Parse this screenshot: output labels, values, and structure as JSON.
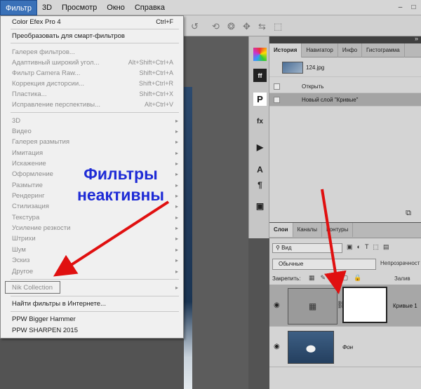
{
  "menubar": {
    "items": [
      "Фильтр",
      "3D",
      "Просмотр",
      "Окно",
      "Справка"
    ],
    "window_buttons": [
      "–",
      "□"
    ]
  },
  "filter_menu": {
    "items": [
      {
        "label": "Color Efex Pro 4",
        "shortcut": "Ctrl+F",
        "disabled": false
      },
      {
        "label": "Преобразовать для смарт-фильтров",
        "shortcut": "",
        "disabled": false
      },
      {
        "label": "Галерея фильтров...",
        "shortcut": "",
        "disabled": true
      },
      {
        "label": "Адаптивный широкий угол...",
        "shortcut": "Alt+Shift+Ctrl+A",
        "disabled": true
      },
      {
        "label": "Фильтр Camera Raw...",
        "shortcut": "Shift+Ctrl+A",
        "disabled": true
      },
      {
        "label": "Коррекция дисторсии...",
        "shortcut": "Shift+Ctrl+R",
        "disabled": true
      },
      {
        "label": "Пластика...",
        "shortcut": "Shift+Ctrl+X",
        "disabled": true
      },
      {
        "label": "Исправление перспективы...",
        "shortcut": "Alt+Ctrl+V",
        "disabled": true
      },
      {
        "label": "3D",
        "submenu": true,
        "disabled": true
      },
      {
        "label": "Видео",
        "submenu": true,
        "disabled": true
      },
      {
        "label": "Галерея размытия",
        "submenu": true,
        "disabled": true
      },
      {
        "label": "Имитация",
        "submenu": true,
        "disabled": true
      },
      {
        "label": "Искажение",
        "submenu": true,
        "disabled": true
      },
      {
        "label": "Оформление",
        "submenu": true,
        "disabled": true
      },
      {
        "label": "Размытие",
        "submenu": true,
        "disabled": true
      },
      {
        "label": "Рендеринг",
        "submenu": true,
        "disabled": true
      },
      {
        "label": "Стилизация",
        "submenu": true,
        "disabled": true
      },
      {
        "label": "Текстура",
        "submenu": true,
        "disabled": true
      },
      {
        "label": "Усиление резкости",
        "submenu": true,
        "disabled": true
      },
      {
        "label": "Штрихи",
        "submenu": true,
        "disabled": true
      },
      {
        "label": "Шум",
        "submenu": true,
        "disabled": true
      },
      {
        "label": "Эскиз",
        "submenu": true,
        "disabled": true
      },
      {
        "label": "Другое",
        "submenu": true,
        "disabled": true
      },
      {
        "label": "Nik Collection",
        "submenu": true,
        "disabled": true
      },
      {
        "label": "Найти фильтры в Интернете...",
        "shortcut": "",
        "disabled": false
      },
      {
        "label": "PPW Bigger Hammer",
        "shortcut": "",
        "disabled": false
      },
      {
        "label": "PPW SHARPEN 2015",
        "shortcut": "",
        "disabled": false
      }
    ]
  },
  "annotation": {
    "line1": "Фильтры",
    "line2": "неактивны"
  },
  "history_panel": {
    "tabs": [
      "История",
      "Навигатор",
      "Инфо",
      "Гистограмма"
    ],
    "snapshot_name": "124.jpg",
    "steps": [
      "Открыть",
      "Новый слой \"Кривые\""
    ]
  },
  "layers_panel": {
    "tabs": [
      "Слои",
      "Каналы",
      "Контуры"
    ],
    "filter_label": "Вид",
    "blend_mode": "Обычные",
    "opacity_label": "Непрозрачност",
    "lock_label": "Закрепить:",
    "fill_label": "Залив",
    "layers": [
      {
        "name": "Кривые 1",
        "selected": true
      },
      {
        "name": "Фон",
        "selected": false
      }
    ]
  },
  "colors": {
    "menu_highlight": "#3a71b8",
    "annotation_text": "#1e2bd6",
    "arrow": "#e01010"
  }
}
